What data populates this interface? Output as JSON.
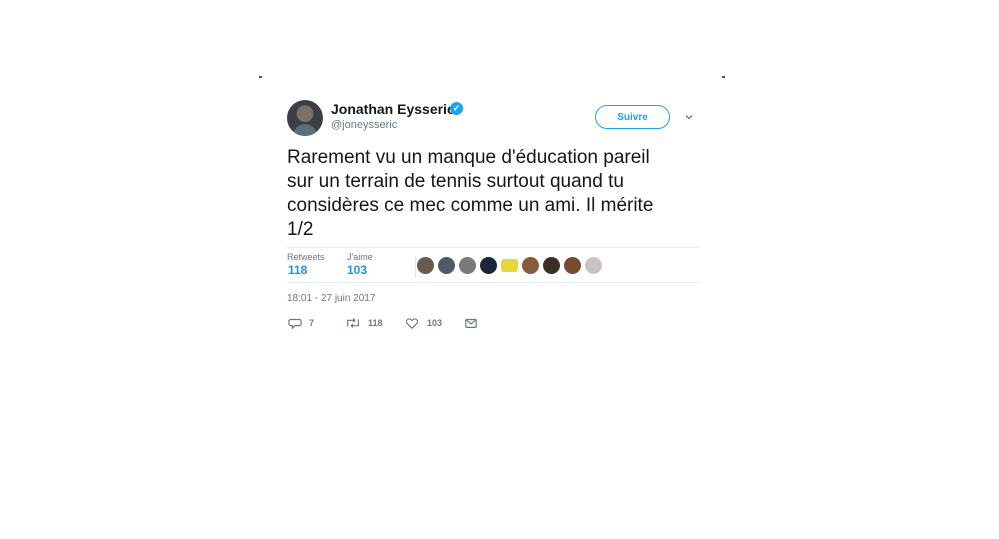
{
  "tweet": {
    "author": {
      "name": "Jonathan Eysseric",
      "handle": "@joneysseric",
      "verified": true
    },
    "follow_label": "Suivre",
    "text_lines": [
      "Rarement vu un manque d'éducation pareil",
      "sur un terrain de tennis surtout quand tu",
      "considères ce mec comme un ami. Il mérite",
      "1/2"
    ],
    "stats": {
      "retweets_label": "Retweets",
      "retweets_value": "118",
      "likes_label": "J'aime",
      "likes_value": "103"
    },
    "liker_avatars": [
      {
        "icon": "user-avatar-icon",
        "color": "#6b5a4c"
      },
      {
        "icon": "user-avatar-icon",
        "color": "#4f5a66"
      },
      {
        "icon": "user-avatar-icon",
        "color": "#7a7a7a"
      },
      {
        "icon": "user-avatar-icon",
        "color": "#3c4f66"
      },
      {
        "icon": "user-avatar-icon",
        "color": "#1b2638"
      },
      {
        "icon": "user-avatar-icon",
        "color": "#e8d53a"
      },
      {
        "icon": "user-avatar-icon",
        "color": "#8a5a3c"
      },
      {
        "icon": "user-avatar-icon",
        "color": "#3a2e26"
      },
      {
        "icon": "user-avatar-icon",
        "color": "#7a4a2e"
      },
      {
        "icon": "user-avatar-icon",
        "color": "#c9c3c9"
      }
    ],
    "timestamp": "18:01 - 27 juin 2017",
    "actions": {
      "reply_count": "7",
      "retweet_count": "118",
      "like_count": "103"
    },
    "colors": {
      "accent": "#1da1f2",
      "link_value": "#1c94e0",
      "muted": "#657786",
      "divider": "#e6ecf0"
    }
  }
}
